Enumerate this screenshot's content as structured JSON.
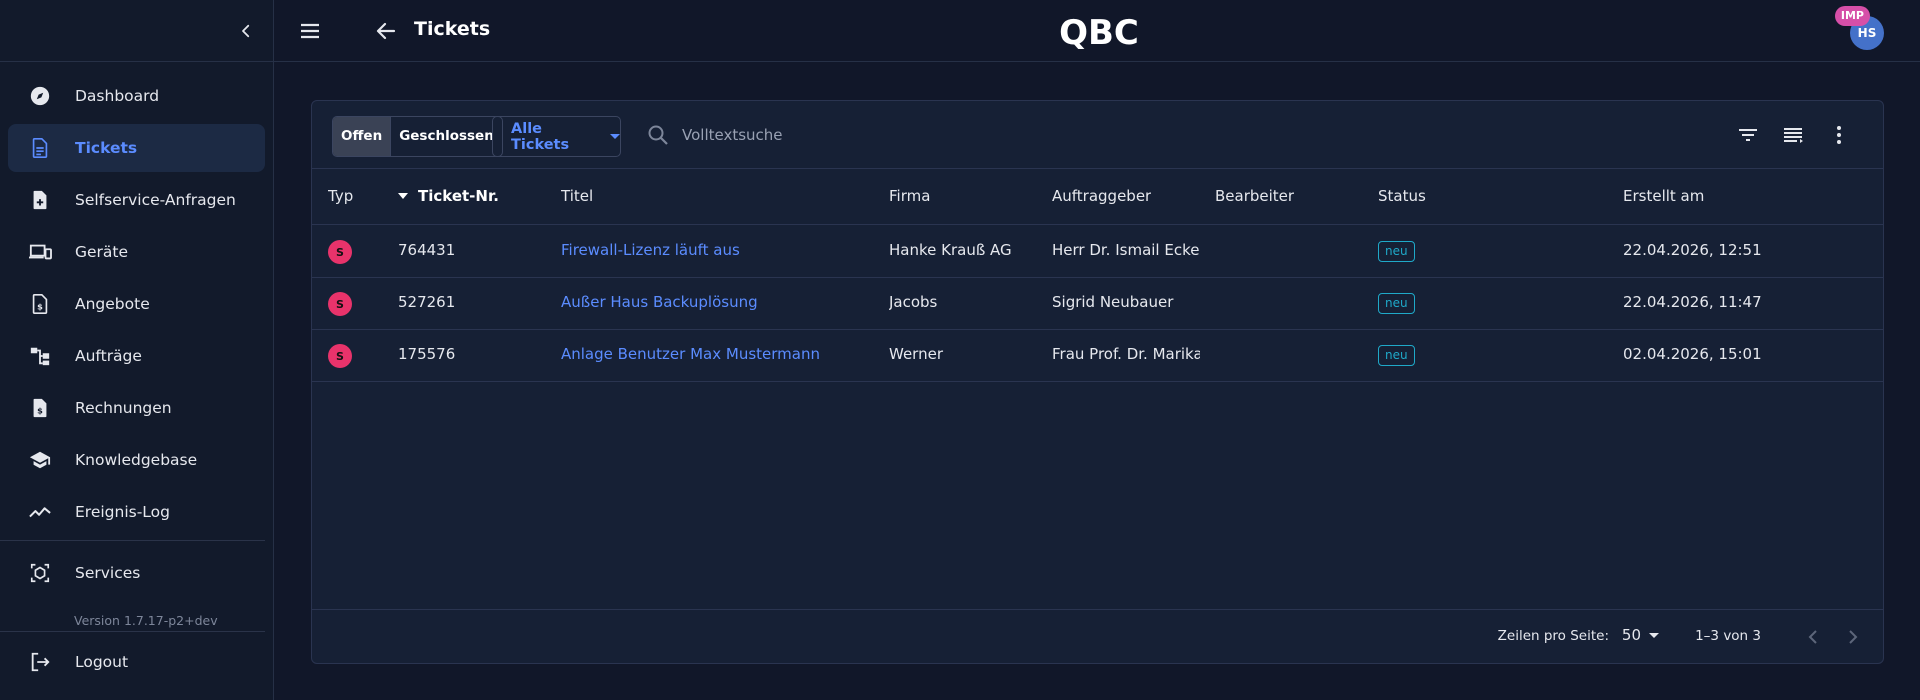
{
  "header": {
    "title": "Tickets",
    "logo_text": "QBC",
    "avatar_initials": "HS",
    "impersonation_badge": "IMP"
  },
  "sidebar": {
    "items": [
      {
        "label": "Dashboard",
        "icon": "compass-icon"
      },
      {
        "label": "Tickets",
        "icon": "document-icon",
        "active": true
      },
      {
        "label": "Selfservice-Anfragen",
        "icon": "document-add-icon"
      },
      {
        "label": "Geräte",
        "icon": "devices-icon"
      },
      {
        "label": "Angebote",
        "icon": "document-dollar-icon"
      },
      {
        "label": "Aufträge",
        "icon": "workflow-icon"
      },
      {
        "label": "Rechnungen",
        "icon": "invoice-icon"
      },
      {
        "label": "Knowledgebase",
        "icon": "graduation-cap-icon"
      },
      {
        "label": "Ereignis-Log",
        "icon": "trend-line-icon"
      }
    ],
    "services_label": "Services",
    "version": "Version 1.7.17-p2+dev",
    "logout_label": "Logout"
  },
  "toolbar": {
    "seg_open": "Offen",
    "seg_closed": "Geschlossen",
    "filter_select": "Alle Tickets",
    "search_placeholder": "Volltextsuche"
  },
  "table": {
    "columns": {
      "typ": "Typ",
      "ticket_nr": "Ticket-Nr.",
      "titel": "Titel",
      "firma": "Firma",
      "auftraggeber": "Auftraggeber",
      "bearbeiter": "Bearbeiter",
      "status": "Status",
      "erstellt": "Erstellt am"
    },
    "rows": [
      {
        "typ": "S",
        "nr": "764431",
        "titel": "Firewall-Lizenz läuft aus",
        "firma": "Hanke Krauß AG",
        "auftraggeber": "Herr Dr. Ismail Eckert I",
        "bearbeiter": "",
        "status": "neu",
        "erstellt": "22.04.2026, 12:51"
      },
      {
        "typ": "S",
        "nr": "527261",
        "titel": "Außer Haus Backuplösung",
        "firma": "Jacobs",
        "auftraggeber": "Sigrid Neubauer",
        "bearbeiter": "",
        "status": "neu",
        "erstellt": "22.04.2026, 11:47"
      },
      {
        "typ": "S",
        "nr": "175576",
        "titel": "Anlage Benutzer Max Mustermann",
        "firma": "Werner",
        "auftraggeber": "Frau Prof. Dr. Marika K",
        "bearbeiter": "",
        "status": "neu",
        "erstellt": "02.04.2026, 15:01"
      }
    ]
  },
  "footer": {
    "rows_per_page_label": "Zeilen pro Seite:",
    "rows_per_page_value": "50",
    "range": "1–3 von 3"
  },
  "colors": {
    "accent": "#5b8cff",
    "status": "#1fa9c9",
    "type_badge": "#e8336b",
    "avatar": "#4471c9",
    "imp_badge": "#d64fa8"
  }
}
